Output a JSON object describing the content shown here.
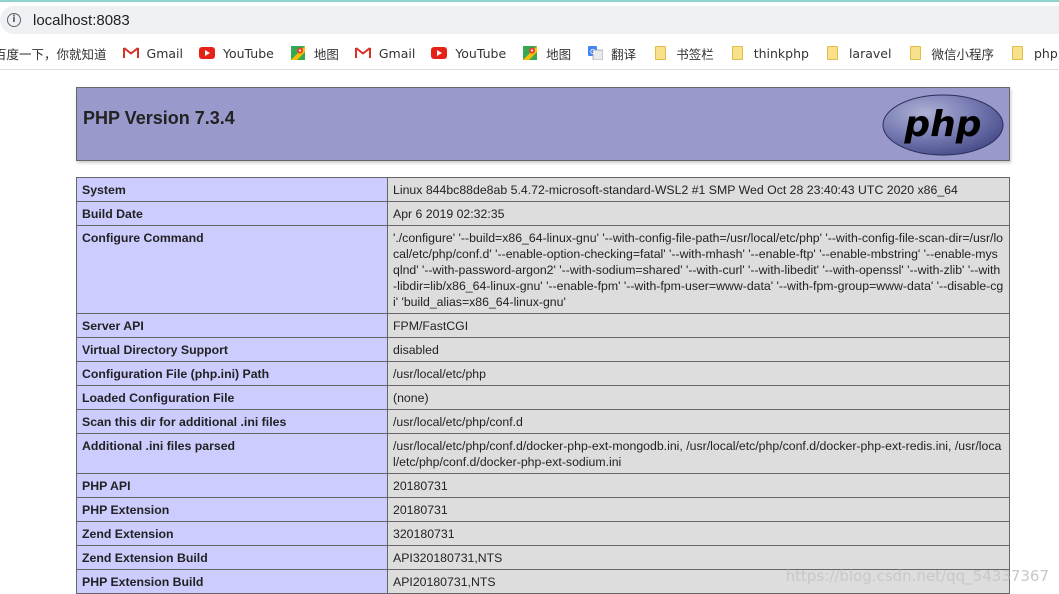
{
  "browser": {
    "url": "localhost:8083",
    "bookmarks": [
      {
        "label": "百度一下，你就知道",
        "icon": "baidu-icon"
      },
      {
        "label": "Gmail",
        "icon": "gmail-icon"
      },
      {
        "label": "YouTube",
        "icon": "youtube-icon"
      },
      {
        "label": "地图",
        "icon": "maps-icon"
      },
      {
        "label": "Gmail",
        "icon": "gmail-icon"
      },
      {
        "label": "YouTube",
        "icon": "youtube-icon"
      },
      {
        "label": "地图",
        "icon": "maps-icon"
      },
      {
        "label": "翻译",
        "icon": "translate-icon"
      },
      {
        "label": "书签栏",
        "icon": "folder-icon"
      },
      {
        "label": "thinkphp",
        "icon": "folder-icon"
      },
      {
        "label": "laravel",
        "icon": "folder-icon"
      },
      {
        "label": "微信小程序",
        "icon": "folder-icon"
      },
      {
        "label": "php",
        "icon": "folder-icon"
      }
    ]
  },
  "header": {
    "title": "PHP Version 7.3.4",
    "logo_text": "php"
  },
  "rows": [
    {
      "key": "System",
      "value": "Linux 844bc88de8ab 5.4.72-microsoft-standard-WSL2 #1 SMP Wed Oct 28 23:40:43 UTC 2020 x86_64"
    },
    {
      "key": "Build Date",
      "value": "Apr 6 2019 02:32:35"
    },
    {
      "key": "Configure Command",
      "value": "'./configure' '--build=x86_64-linux-gnu' '--with-config-file-path=/usr/local/etc/php' '--with-config-file-scan-dir=/usr/local/etc/php/conf.d' '--enable-option-checking=fatal' '--with-mhash' '--enable-ftp' '--enable-mbstring' '--enable-mysqlnd' '--with-password-argon2' '--with-sodium=shared' '--with-curl' '--with-libedit' '--with-openssl' '--with-zlib' '--with-libdir=lib/x86_64-linux-gnu' '--enable-fpm' '--with-fpm-user=www-data' '--with-fpm-group=www-data' '--disable-cgi' 'build_alias=x86_64-linux-gnu'"
    },
    {
      "key": "Server API",
      "value": "FPM/FastCGI"
    },
    {
      "key": "Virtual Directory Support",
      "value": "disabled"
    },
    {
      "key": "Configuration File (php.ini) Path",
      "value": "/usr/local/etc/php"
    },
    {
      "key": "Loaded Configuration File",
      "value": "(none)"
    },
    {
      "key": "Scan this dir for additional .ini files",
      "value": "/usr/local/etc/php/conf.d"
    },
    {
      "key": "Additional .ini files parsed",
      "value": "/usr/local/etc/php/conf.d/docker-php-ext-mongodb.ini, /usr/local/etc/php/conf.d/docker-php-ext-redis.ini, /usr/local/etc/php/conf.d/docker-php-ext-sodium.ini"
    },
    {
      "key": "PHP API",
      "value": "20180731"
    },
    {
      "key": "PHP Extension",
      "value": "20180731"
    },
    {
      "key": "Zend Extension",
      "value": "320180731"
    },
    {
      "key": "Zend Extension Build",
      "value": "API320180731,NTS"
    },
    {
      "key": "PHP Extension Build",
      "value": "API20180731,NTS"
    }
  ],
  "watermark": "https://blog.csdn.net/qq_54337367",
  "colors": {
    "header_bg": "#9999cc",
    "key_cell_bg": "#ccccff",
    "value_cell_bg": "#dddddd"
  }
}
